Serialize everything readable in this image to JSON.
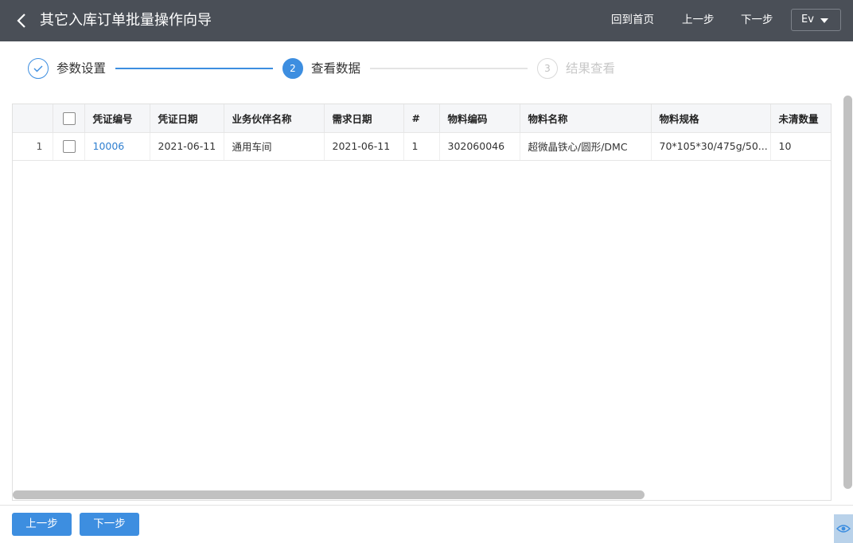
{
  "header": {
    "title": "其它入库订单批量操作向导",
    "home": "回到首页",
    "prev": "上一步",
    "next": "下一步",
    "user": "Ev"
  },
  "steps": [
    {
      "number": "1",
      "label": "参数设置",
      "state": "done"
    },
    {
      "number": "2",
      "label": "查看数据",
      "state": "active"
    },
    {
      "number": "3",
      "label": "结果查看",
      "state": "pending"
    }
  ],
  "table": {
    "columns": [
      "凭证编号",
      "凭证日期",
      "业务伙伴名称",
      "需求日期",
      "#",
      "物料编码",
      "物料名称",
      "物料规格",
      "未清数量"
    ],
    "rows": [
      {
        "rownum": "1",
        "doc_no": "10006",
        "doc_date": "2021-06-11",
        "partner": "通用车间",
        "req_date": "2021-06-11",
        "line": "1",
        "item_code": "302060046",
        "item_name": "超微晶铁心/圆形/DMC",
        "item_spec": "70*105*30/475g/50...",
        "open_qty": "10"
      }
    ]
  },
  "footer": {
    "prev": "上一步",
    "next": "下一步"
  },
  "colors": {
    "topbar": "#4a4f57",
    "accent": "#3d8ee0",
    "link": "#2f7fd0"
  }
}
